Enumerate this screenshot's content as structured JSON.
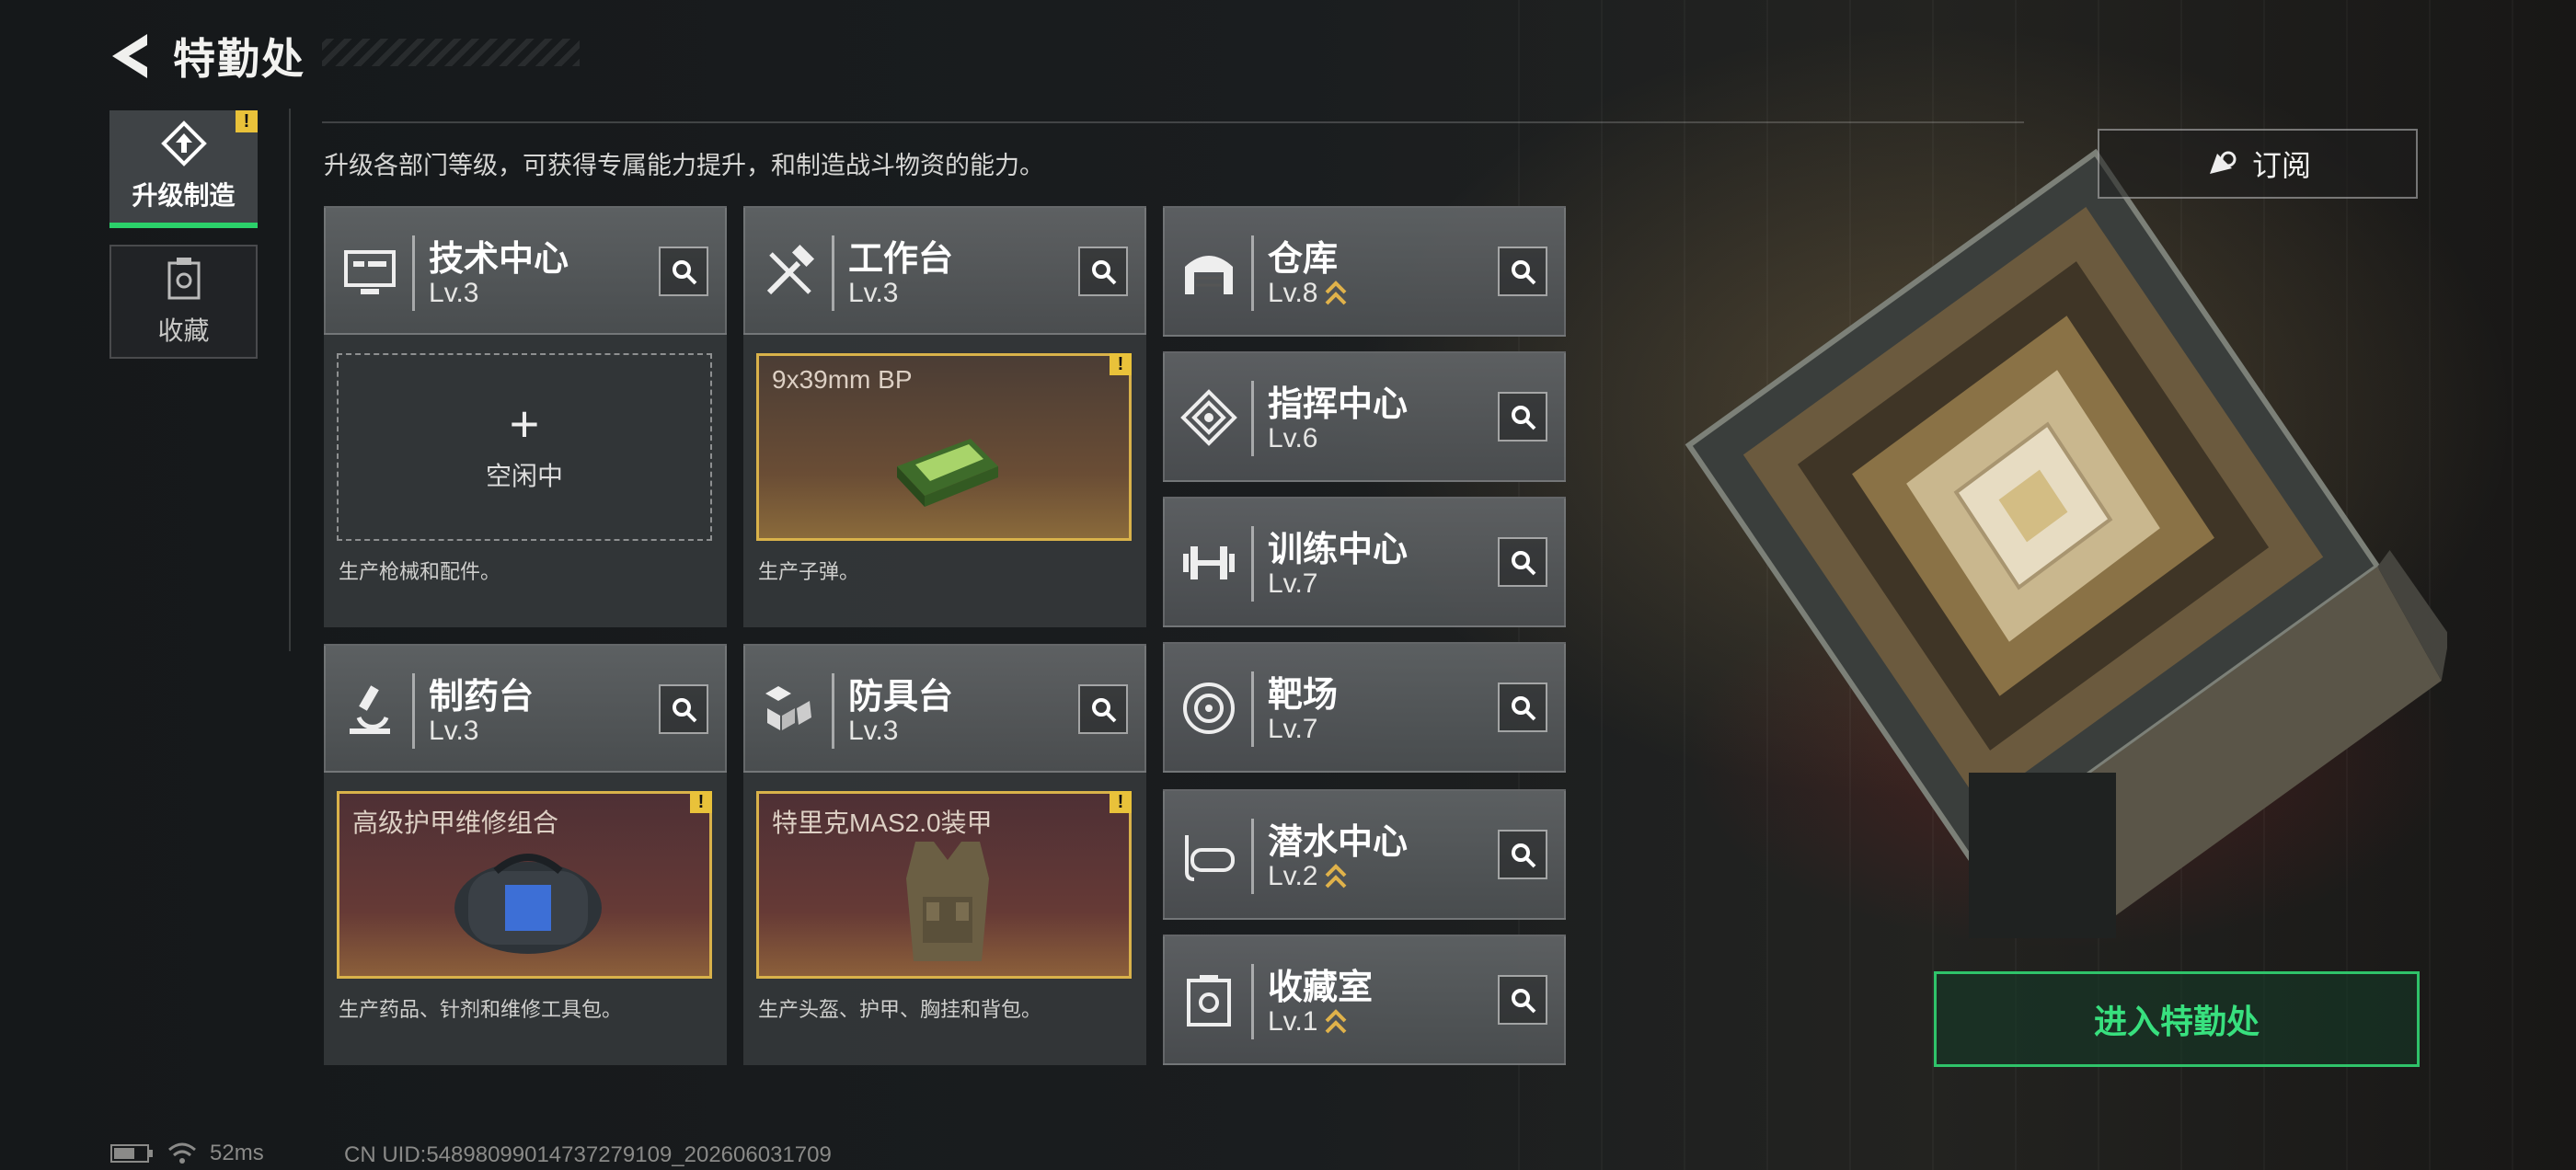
{
  "header": {
    "title": "特勤处"
  },
  "tabs": [
    {
      "label": "升级制造",
      "active": true,
      "icon": "upgrade-icon",
      "alert": "!"
    },
    {
      "label": "收藏",
      "active": false,
      "icon": "collection-icon"
    }
  ],
  "description": "升级各部门等级，可获得专属能力提升，和制造战斗物资的能力。",
  "subscribe": {
    "label": "订阅"
  },
  "enter_button": {
    "label": "进入特勤处"
  },
  "departments_large": [
    {
      "name": "技术中心",
      "level": "Lv.3",
      "icon": "monitor-icon",
      "slot": {
        "state": "empty",
        "plus": "+",
        "label": "空闲中"
      },
      "footer": "生产枪械和配件。"
    },
    {
      "name": "工作台",
      "level": "Lv.3",
      "icon": "tools-icon",
      "slot": {
        "state": "item",
        "item_name": "9x39mm BP",
        "item_icon": "ammo-box-icon",
        "alert": "!"
      },
      "footer": "生产子弹。"
    },
    {
      "name": "制药台",
      "level": "Lv.3",
      "icon": "microscope-icon",
      "slot": {
        "state": "item",
        "item_name": "高级护甲维修组合",
        "item_icon": "repair-bag-icon",
        "alert": "!"
      },
      "footer": "生产药品、针剂和维修工具包。"
    },
    {
      "name": "防具台",
      "level": "Lv.3",
      "icon": "cubes-icon",
      "slot": {
        "state": "item",
        "item_name": "特里克MAS2.0装甲",
        "item_icon": "armor-vest-icon",
        "alert": "!"
      },
      "footer": "生产头盔、护甲、胸挂和背包。"
    }
  ],
  "departments_small": [
    {
      "name": "仓库",
      "level": "Lv.8",
      "icon": "warehouse-icon",
      "upgradable": true
    },
    {
      "name": "指挥中心",
      "level": "Lv.6",
      "icon": "command-icon",
      "upgradable": false
    },
    {
      "name": "训练中心",
      "level": "Lv.7",
      "icon": "dumbbell-icon",
      "upgradable": false
    },
    {
      "name": "靶场",
      "level": "Lv.7",
      "icon": "target-icon",
      "upgradable": false
    },
    {
      "name": "潜水中心",
      "level": "Lv.2",
      "icon": "diving-mask-icon",
      "upgradable": true
    },
    {
      "name": "收藏室",
      "level": "Lv.1",
      "icon": "trophy-room-icon",
      "upgradable": true
    }
  ],
  "status": {
    "ping": "52ms",
    "uid": "CN UID:54898099014737279109_202606031709"
  },
  "colors": {
    "accent_green": "#2bd16a",
    "alert_yellow": "#e9c23a",
    "slot_border": "#d9b24a"
  }
}
